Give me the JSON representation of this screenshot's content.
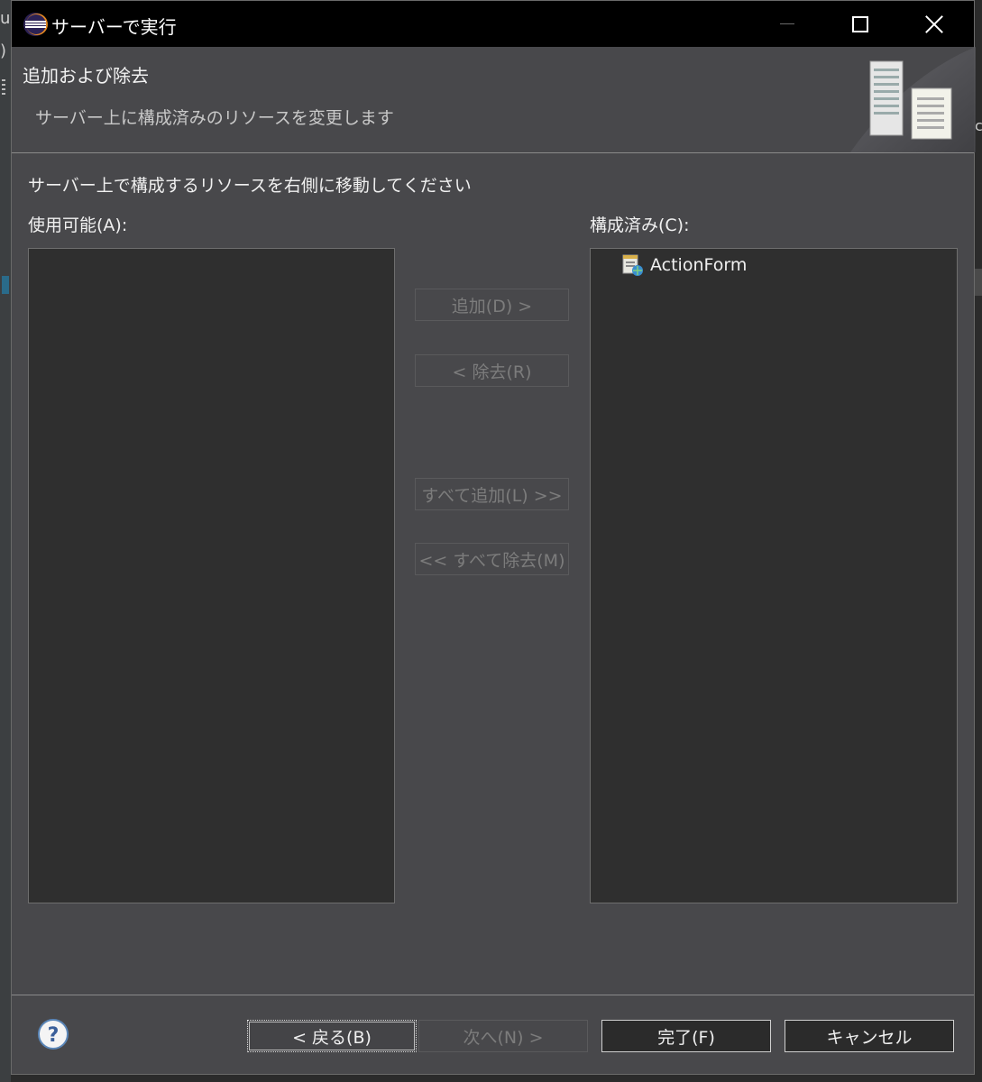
{
  "dialog": {
    "title": "サーバーで実行",
    "header_title": "追加および除去",
    "header_description": "サーバー上に構成済みのリソースを変更します",
    "instruction": "サーバー上で構成するリソースを右側に移動してください"
  },
  "lists": {
    "available_label": "使用可能(A):",
    "available_items": [],
    "configured_label": "構成済み(C):",
    "configured_items": [
      {
        "label": "ActionForm",
        "icon": "web-module-icon"
      }
    ]
  },
  "buttons": {
    "add": "追加(D) >",
    "remove": "< 除去(R)",
    "add_all": "すべて追加(L) >>",
    "remove_all": "<< すべて除去(M)",
    "back": "< 戻る(B)",
    "next": "次へ(N) >",
    "finish": "完了(F)",
    "cancel": "キャンセル"
  },
  "background_fragments": {
    "left_top": "u",
    "left_second": ")",
    "right": "c"
  },
  "colors": {
    "title_bar": "#000000",
    "dialog_bg": "#48484b",
    "list_bg": "#2f2f2f",
    "disabled_text": "#7c7c7c"
  }
}
